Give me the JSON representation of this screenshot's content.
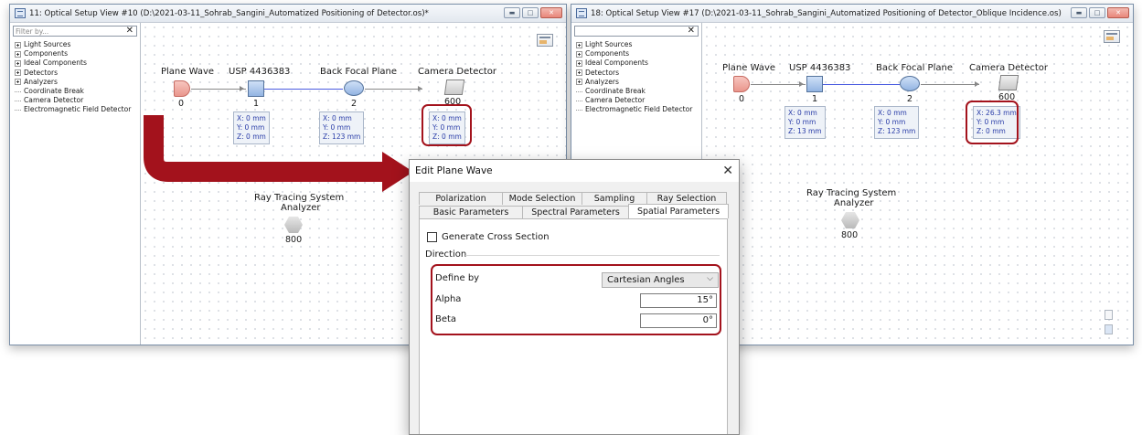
{
  "left_window": {
    "title": "11: Optical Setup View #10 (D:\\2021-03-11_Sohrab_Sangini_Automatized Positioning of Detector.os)*",
    "filter_placeholder": "Filter by...",
    "tree": [
      "Light Sources",
      "Components",
      "Ideal Components",
      "Detectors",
      "Analyzers",
      "Coordinate Break",
      "Camera Detector",
      "Electromagnetic Field Detector"
    ],
    "elements": [
      {
        "label": "Plane Wave",
        "index": "0"
      },
      {
        "label": "USP 4436383",
        "index": "1",
        "coords": [
          "X: 0 mm",
          "Y: 0 mm",
          "Z: 0 mm"
        ]
      },
      {
        "label": "Back Focal Plane",
        "index": "2",
        "coords": [
          "X: 0 mm",
          "Y: 0 mm",
          "Z: 123 mm"
        ]
      },
      {
        "label": "Camera Detector",
        "index": "600",
        "coords": [
          "X: 0 mm",
          "Y: 0 mm",
          "Z: 0 mm"
        ]
      }
    ],
    "analyzer": {
      "label_line1": "Ray Tracing System",
      "label_line2": "Analyzer",
      "index": "800"
    }
  },
  "right_window": {
    "title": "18: Optical Setup View #17 (D:\\2021-03-11_Sohrab_Sangini_Automatized Positioning of Detector_Oblique Incidence.os)",
    "tree": [
      "Light Sources",
      "Components",
      "Ideal Components",
      "Detectors",
      "Analyzers",
      "Coordinate Break",
      "Camera Detector",
      "Electromagnetic Field Detector"
    ],
    "elements": [
      {
        "label": "Plane Wave",
        "index": "0"
      },
      {
        "label": "USP 4436383",
        "index": "1",
        "coords": [
          "X: 0 mm",
          "Y: 0 mm",
          "Z: 13 mm"
        ]
      },
      {
        "label": "Back Focal Plane",
        "index": "2",
        "coords": [
          "X: 0 mm",
          "Y: 0 mm",
          "Z: 123 mm"
        ]
      },
      {
        "label": "Camera Detector",
        "index": "600",
        "coords": [
          "X: 26.3 mm",
          "Y: 0 mm",
          "Z: 0 mm"
        ]
      }
    ],
    "analyzer": {
      "label_line1": "Ray Tracing System",
      "label_line2": "Analyzer",
      "index": "800"
    }
  },
  "dialog": {
    "title": "Edit Plane Wave",
    "tabs_row1": [
      "Polarization",
      "Mode Selection",
      "Sampling",
      "Ray Selection"
    ],
    "tabs_row2": [
      "Basic Parameters",
      "Spectral Parameters",
      "Spatial Parameters"
    ],
    "active_tab": "Spatial Parameters",
    "generate_cross_section": "Generate Cross Section",
    "direction_group": "Direction",
    "define_by_label": "Define by",
    "define_by_value": "Cartesian Angles",
    "alpha_label": "Alpha",
    "alpha_value": "15°",
    "beta_label": "Beta",
    "beta_value": "0°"
  },
  "colors": {
    "highlight_red": "#a3121c",
    "coord_text": "#2a3da8",
    "connection_line": "#4a5be0"
  }
}
